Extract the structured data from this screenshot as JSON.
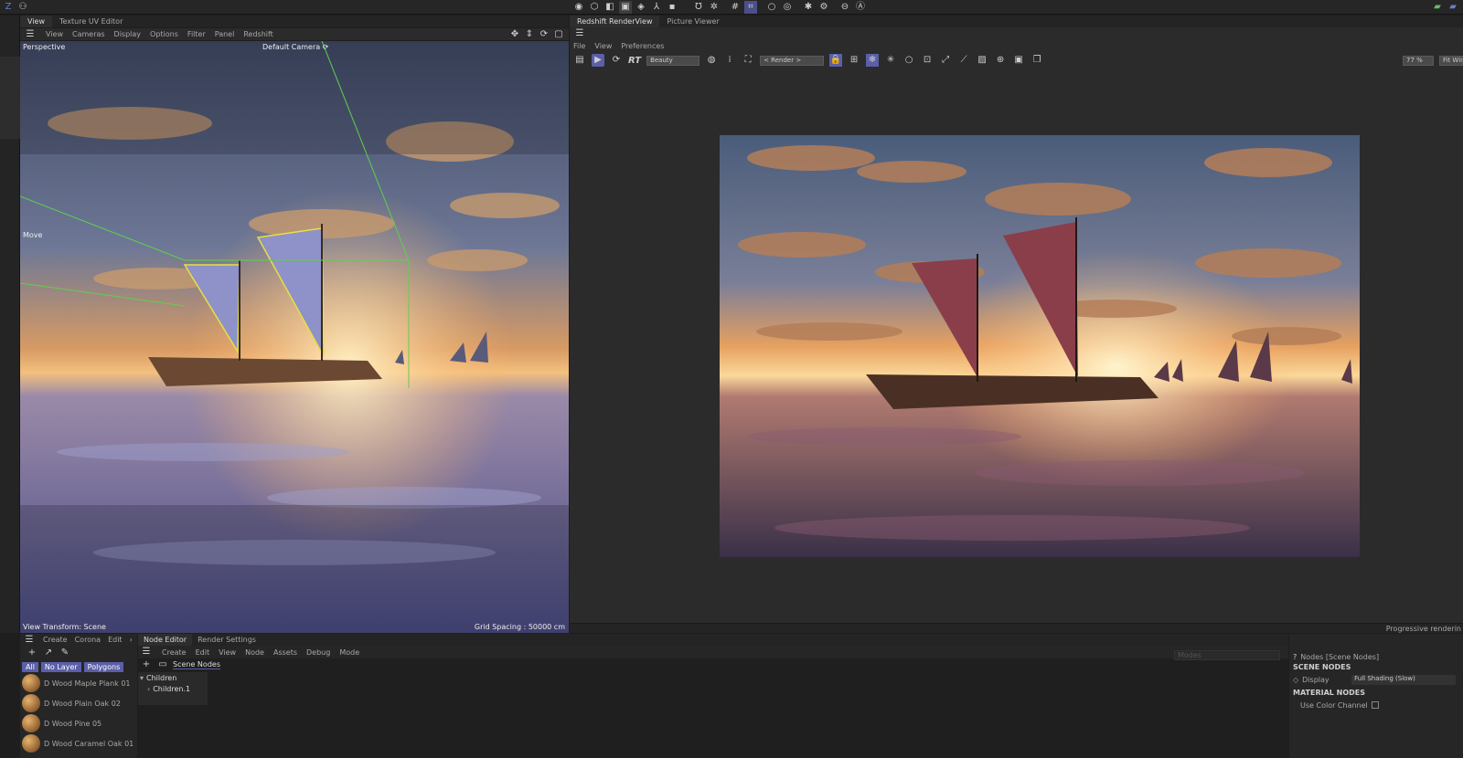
{
  "top_bar": {
    "icons": [
      "cube-icon",
      "sphere-icon",
      "box-icon",
      "poly-icon",
      "merge-icon",
      "axis-icon",
      "camera-icon",
      "light-icon",
      "grid-icon",
      "snap-icon",
      "circle-icon",
      "dot-icon",
      "bug-icon",
      "gear-icon",
      "lock-icon",
      "a-icon"
    ]
  },
  "left_tabs": {
    "view": "View",
    "texture_uv": "Texture UV Editor"
  },
  "viewport_menu": [
    "View",
    "Cameras",
    "Display",
    "Options",
    "Filter",
    "Panel",
    "Redshift"
  ],
  "viewport": {
    "label_perspective": "Perspective",
    "label_camera": "Default Camera ⟳",
    "label_move": "Move",
    "transform": "View Transform: Scene",
    "grid_spacing": "Grid Spacing : 50000 cm"
  },
  "render_tabs": {
    "renderview": "Redshift RenderView",
    "picture_viewer": "Picture Viewer"
  },
  "render_menu": [
    "File",
    "View",
    "Preferences"
  ],
  "render_toolbar": {
    "rt": "RT",
    "beauty": "Beauty",
    "render_select": "< Render >",
    "zoom": "77 %",
    "fit": "Fit Window"
  },
  "render_status": "Progressive renderin",
  "bottom_left": {
    "tabs": [
      "Create",
      "Corona",
      "Edit"
    ],
    "filters": [
      "All",
      "No Layer",
      "Polygons"
    ],
    "materials": [
      "D Wood Maple Plank 01",
      "D Wood Plain Oak 02",
      "D Wood Pine 05",
      "D Wood Caramel Oak 01"
    ]
  },
  "node_editor": {
    "tabs": [
      "Node Editor",
      "Render Settings"
    ],
    "menu": [
      "Create",
      "Edit",
      "View",
      "Node",
      "Assets",
      "Debug",
      "Mode"
    ],
    "scene_nodes": "Scene Nodes",
    "tree": [
      "Children",
      "Children.1"
    ],
    "search_placeholder": "Modes"
  },
  "properties": {
    "title": "Nodes [Scene Nodes]",
    "scene_nodes_header": "SCENE NODES",
    "display_label": "Display",
    "display_value": "Full Shading (Slow)",
    "material_nodes_header": "MATERIAL NODES",
    "use_color_channel": "Use Color Channel"
  },
  "colors": {
    "accent": "#5b5fa8",
    "panel": "#2b2b2b",
    "dark": "#1b1b1b"
  }
}
